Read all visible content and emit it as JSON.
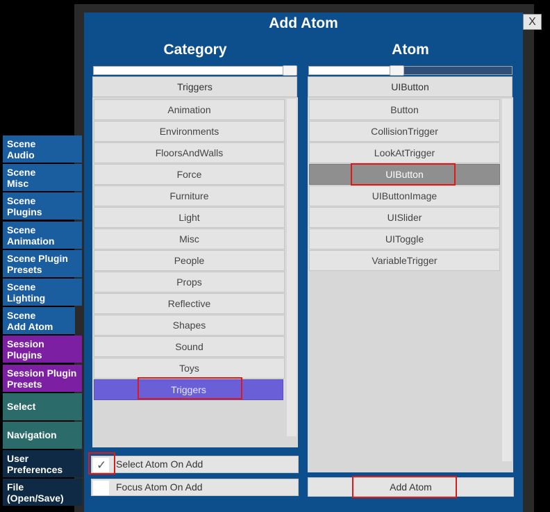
{
  "window": {
    "title": "Add Atom",
    "close_label": "X"
  },
  "category": {
    "header": "Category",
    "selected": "Triggers",
    "items": [
      "Animation",
      "Environments",
      "FloorsAndWalls",
      "Force",
      "Furniture",
      "Light",
      "Misc",
      "People",
      "Props",
      "Reflective",
      "Shapes",
      "Sound",
      "Toys",
      "Triggers"
    ],
    "selected_item_index": 13,
    "slider_value": 1.0
  },
  "atom": {
    "header": "Atom",
    "selected": "UIButton",
    "items": [
      "Button",
      "CollisionTrigger",
      "LookAtTrigger",
      "UIButton",
      "UIButtonImage",
      "UISlider",
      "UIToggle",
      "VariableTrigger"
    ],
    "selected_item_index": 3,
    "slider_value": 0.43
  },
  "options": {
    "select_on_add": {
      "label": "Select Atom On Add",
      "checked": true,
      "check_glyph": "✓"
    },
    "focus_on_add": {
      "label": "Focus Atom On Add",
      "checked": false
    }
  },
  "add_button_label": "Add Atom",
  "sidebar": {
    "items": [
      {
        "label": "Scene\nAudio",
        "color": "blue"
      },
      {
        "label": "Scene\nMisc",
        "color": "blue"
      },
      {
        "label": "Scene\nPlugins",
        "color": "blue"
      },
      {
        "label": "Scene\nAnimation",
        "color": "blue"
      },
      {
        "label": "Scene Plugin\nPresets",
        "color": "blue"
      },
      {
        "label": "Scene\nLighting",
        "color": "blue"
      },
      {
        "label": "Scene\nAdd Atom",
        "color": "blue",
        "active": true
      },
      {
        "label": "Session\nPlugins",
        "color": "purple"
      },
      {
        "label": "Session Plugin\nPresets",
        "color": "purple"
      },
      {
        "label": "Select",
        "color": "teal"
      },
      {
        "label": "Navigation",
        "color": "teal"
      },
      {
        "label": "User\nPreferences",
        "color": "dark"
      },
      {
        "label": "File\n(Open/Save)",
        "color": "dark"
      }
    ]
  },
  "colors": {
    "panel": "#0d4f8c",
    "selected_category": "#6a5fd6",
    "selected_atom": "#8f8f8f",
    "highlight": "#e01818"
  }
}
